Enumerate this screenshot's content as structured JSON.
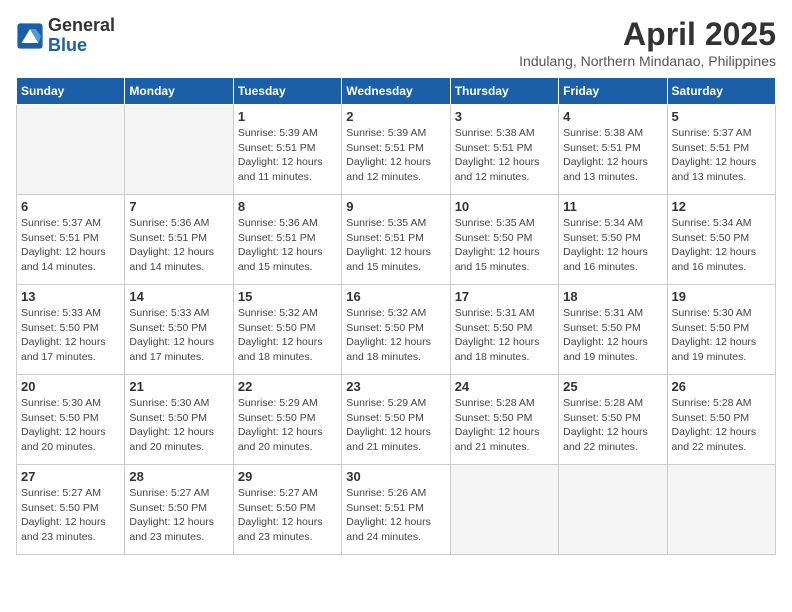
{
  "logo": {
    "general": "General",
    "blue": "Blue"
  },
  "title": "April 2025",
  "subtitle": "Indulang, Northern Mindanao, Philippines",
  "days_header": [
    "Sunday",
    "Monday",
    "Tuesday",
    "Wednesday",
    "Thursday",
    "Friday",
    "Saturday"
  ],
  "weeks": [
    [
      {
        "day": "",
        "info": ""
      },
      {
        "day": "",
        "info": ""
      },
      {
        "day": "1",
        "sunrise": "5:39 AM",
        "sunset": "5:51 PM",
        "daylight": "12 hours and 11 minutes."
      },
      {
        "day": "2",
        "sunrise": "5:39 AM",
        "sunset": "5:51 PM",
        "daylight": "12 hours and 12 minutes."
      },
      {
        "day": "3",
        "sunrise": "5:38 AM",
        "sunset": "5:51 PM",
        "daylight": "12 hours and 12 minutes."
      },
      {
        "day": "4",
        "sunrise": "5:38 AM",
        "sunset": "5:51 PM",
        "daylight": "12 hours and 13 minutes."
      },
      {
        "day": "5",
        "sunrise": "5:37 AM",
        "sunset": "5:51 PM",
        "daylight": "12 hours and 13 minutes."
      }
    ],
    [
      {
        "day": "6",
        "sunrise": "5:37 AM",
        "sunset": "5:51 PM",
        "daylight": "12 hours and 14 minutes."
      },
      {
        "day": "7",
        "sunrise": "5:36 AM",
        "sunset": "5:51 PM",
        "daylight": "12 hours and 14 minutes."
      },
      {
        "day": "8",
        "sunrise": "5:36 AM",
        "sunset": "5:51 PM",
        "daylight": "12 hours and 15 minutes."
      },
      {
        "day": "9",
        "sunrise": "5:35 AM",
        "sunset": "5:51 PM",
        "daylight": "12 hours and 15 minutes."
      },
      {
        "day": "10",
        "sunrise": "5:35 AM",
        "sunset": "5:50 PM",
        "daylight": "12 hours and 15 minutes."
      },
      {
        "day": "11",
        "sunrise": "5:34 AM",
        "sunset": "5:50 PM",
        "daylight": "12 hours and 16 minutes."
      },
      {
        "day": "12",
        "sunrise": "5:34 AM",
        "sunset": "5:50 PM",
        "daylight": "12 hours and 16 minutes."
      }
    ],
    [
      {
        "day": "13",
        "sunrise": "5:33 AM",
        "sunset": "5:50 PM",
        "daylight": "12 hours and 17 minutes."
      },
      {
        "day": "14",
        "sunrise": "5:33 AM",
        "sunset": "5:50 PM",
        "daylight": "12 hours and 17 minutes."
      },
      {
        "day": "15",
        "sunrise": "5:32 AM",
        "sunset": "5:50 PM",
        "daylight": "12 hours and 18 minutes."
      },
      {
        "day": "16",
        "sunrise": "5:32 AM",
        "sunset": "5:50 PM",
        "daylight": "12 hours and 18 minutes."
      },
      {
        "day": "17",
        "sunrise": "5:31 AM",
        "sunset": "5:50 PM",
        "daylight": "12 hours and 18 minutes."
      },
      {
        "day": "18",
        "sunrise": "5:31 AM",
        "sunset": "5:50 PM",
        "daylight": "12 hours and 19 minutes."
      },
      {
        "day": "19",
        "sunrise": "5:30 AM",
        "sunset": "5:50 PM",
        "daylight": "12 hours and 19 minutes."
      }
    ],
    [
      {
        "day": "20",
        "sunrise": "5:30 AM",
        "sunset": "5:50 PM",
        "daylight": "12 hours and 20 minutes."
      },
      {
        "day": "21",
        "sunrise": "5:30 AM",
        "sunset": "5:50 PM",
        "daylight": "12 hours and 20 minutes."
      },
      {
        "day": "22",
        "sunrise": "5:29 AM",
        "sunset": "5:50 PM",
        "daylight": "12 hours and 20 minutes."
      },
      {
        "day": "23",
        "sunrise": "5:29 AM",
        "sunset": "5:50 PM",
        "daylight": "12 hours and 21 minutes."
      },
      {
        "day": "24",
        "sunrise": "5:28 AM",
        "sunset": "5:50 PM",
        "daylight": "12 hours and 21 minutes."
      },
      {
        "day": "25",
        "sunrise": "5:28 AM",
        "sunset": "5:50 PM",
        "daylight": "12 hours and 22 minutes."
      },
      {
        "day": "26",
        "sunrise": "5:28 AM",
        "sunset": "5:50 PM",
        "daylight": "12 hours and 22 minutes."
      }
    ],
    [
      {
        "day": "27",
        "sunrise": "5:27 AM",
        "sunset": "5:50 PM",
        "daylight": "12 hours and 23 minutes."
      },
      {
        "day": "28",
        "sunrise": "5:27 AM",
        "sunset": "5:50 PM",
        "daylight": "12 hours and 23 minutes."
      },
      {
        "day": "29",
        "sunrise": "5:27 AM",
        "sunset": "5:50 PM",
        "daylight": "12 hours and 23 minutes."
      },
      {
        "day": "30",
        "sunrise": "5:26 AM",
        "sunset": "5:51 PM",
        "daylight": "12 hours and 24 minutes."
      },
      {
        "day": "",
        "info": ""
      },
      {
        "day": "",
        "info": ""
      },
      {
        "day": "",
        "info": ""
      }
    ]
  ]
}
